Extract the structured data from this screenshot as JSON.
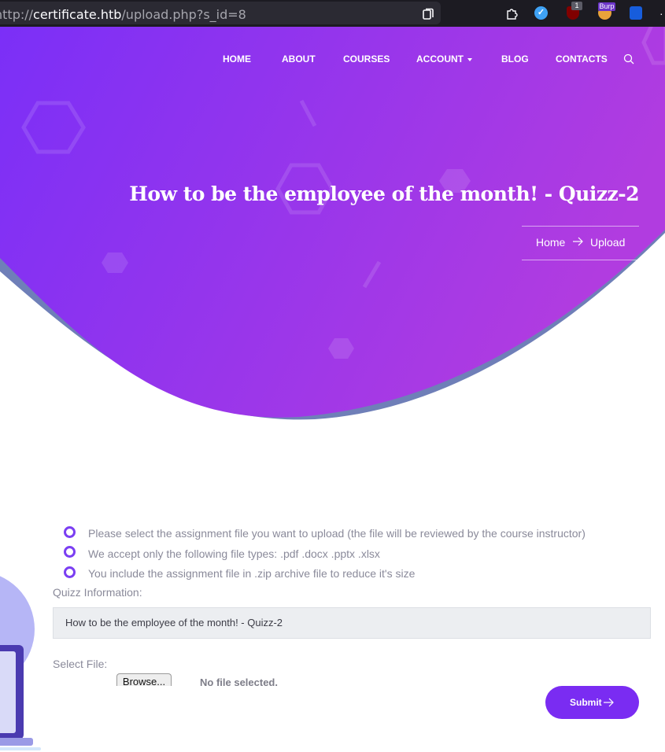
{
  "browser": {
    "url_scheme": "http://",
    "url_host": "certificate.htb",
    "url_path": "/upload.php?s_id=8",
    "extensions": [
      {
        "name": "extensions-icon"
      },
      {
        "name": "vimium-icon"
      },
      {
        "name": "ublock-icon",
        "badge": "1"
      },
      {
        "name": "burp-icon",
        "badge": "Burp"
      },
      {
        "name": "bitwarden-icon"
      }
    ]
  },
  "nav": {
    "items": [
      "HOME",
      "ABOUT",
      "COURSES",
      "ACCOUNT",
      "BLOG",
      "CONTACTS"
    ]
  },
  "hero": {
    "title": "How to be the employee of the month! - Quizz-2",
    "breadcrumb": {
      "home": "Home",
      "current": "Upload"
    },
    "colors": {
      "start": "#7b2ff7",
      "end": "#b13ce0",
      "shadow": "#6f7fb8"
    }
  },
  "upload": {
    "notes": [
      "Please select the assignment file you want to upload (the file will be reviewed by the course instructor)",
      "We accept only the following file types: .pdf .docx .pptx .xlsx",
      "You include the assignment file in .zip archive file to reduce it's size"
    ],
    "quiz_info_label": "Quizz Information:",
    "quiz_info_value": "How to be the employee of the month! - Quizz-2",
    "select_file_label": "Select File:",
    "browse_label": "Browse...",
    "file_status": "No file selected.",
    "submit_label": "Submit"
  },
  "accent_color": "#7a2cf2"
}
